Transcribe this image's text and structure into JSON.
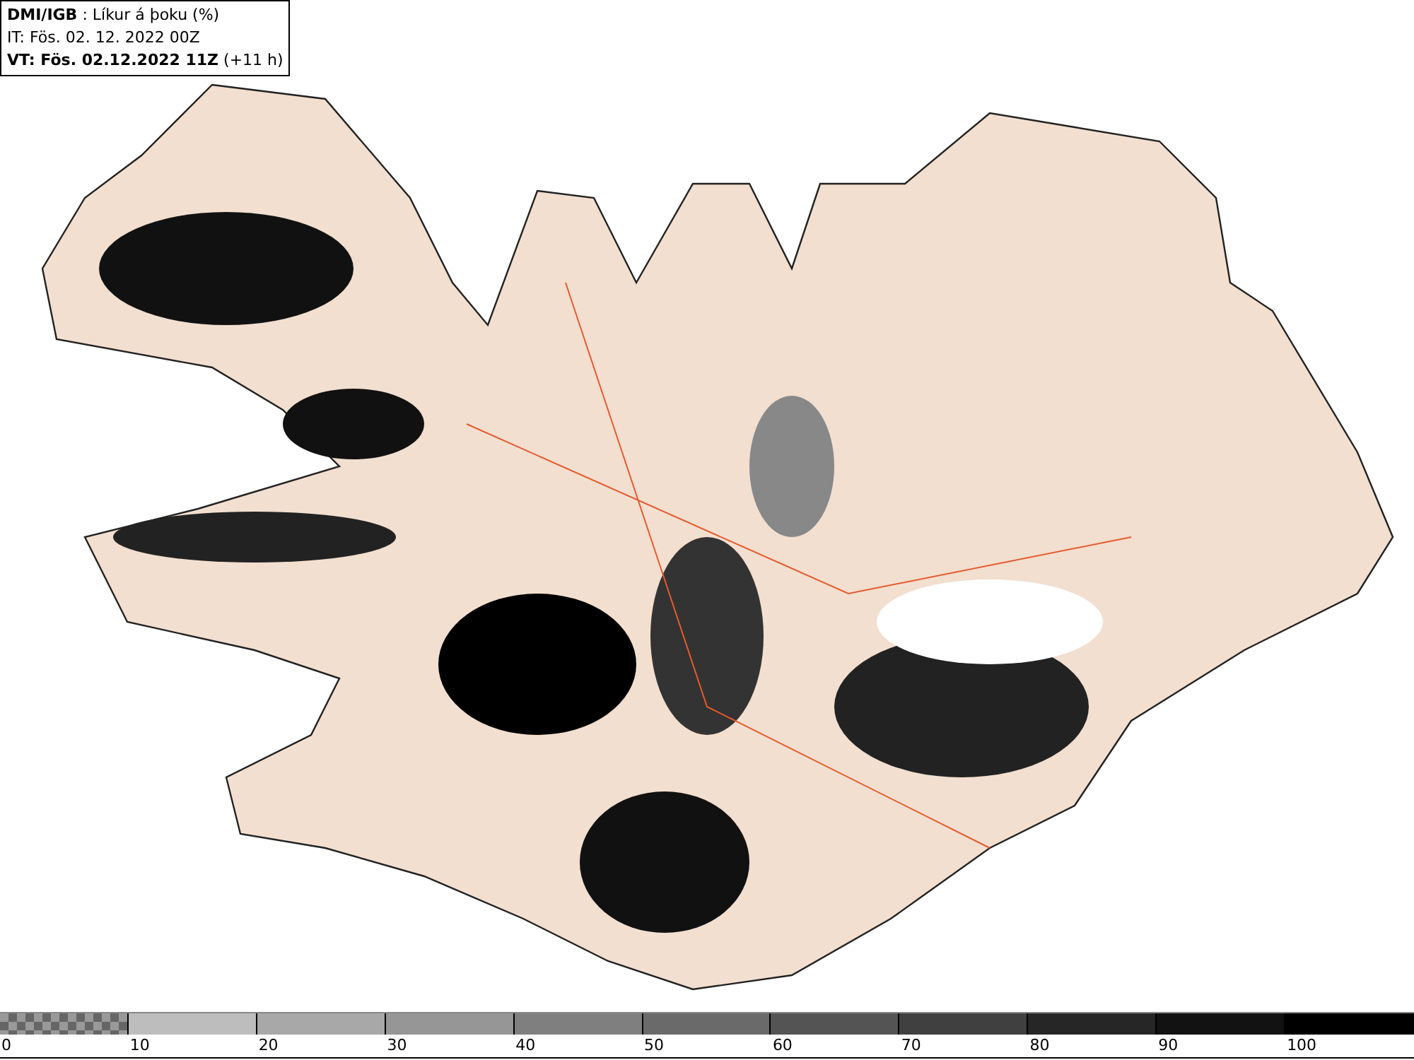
{
  "header": {
    "source": "DMI/IGB",
    "product": " : Líkur á þoku (%)",
    "issue_time": "IT: Fös. 02. 12. 2022 00Z",
    "valid_label": "VT: Fös. 02.12.2022 11Z",
    "lead_time": "(+11 h)"
  },
  "legend": {
    "segments": [
      {
        "kind": "checker",
        "color": "#666666",
        "label": "0"
      },
      {
        "kind": "solid",
        "color": "#bdbdbd",
        "label": "10"
      },
      {
        "kind": "solid",
        "color": "#a8a8a8",
        "label": "20"
      },
      {
        "kind": "solid",
        "color": "#969696",
        "label": "30"
      },
      {
        "kind": "solid",
        "color": "#7f7f7f",
        "label": "40"
      },
      {
        "kind": "solid",
        "color": "#6a6a6a",
        "label": "50"
      },
      {
        "kind": "solid",
        "color": "#545454",
        "label": "60"
      },
      {
        "kind": "solid",
        "color": "#404040",
        "label": "70"
      },
      {
        "kind": "solid",
        "color": "#262626",
        "label": "80"
      },
      {
        "kind": "solid",
        "color": "#121212",
        "label": "90"
      },
      {
        "kind": "solid",
        "color": "#000000",
        "label": "100"
      }
    ]
  }
}
